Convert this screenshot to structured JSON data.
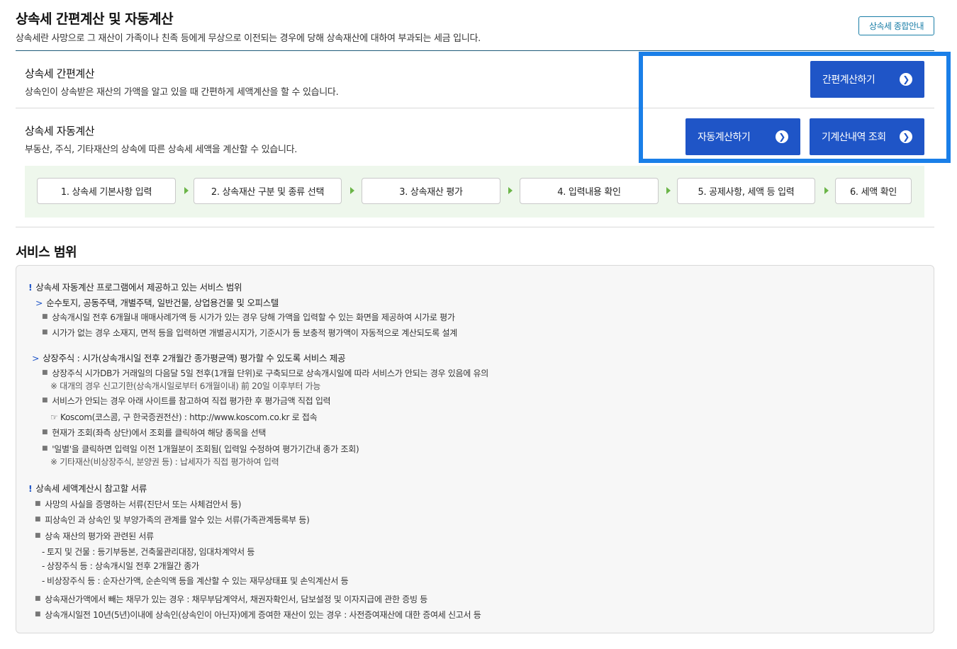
{
  "header": {
    "title": "상속세 간편계산 및 자동계산",
    "description": "상속세란 사망으로 그 재산이 가족이나 친족 등에게 무상으로 이전되는 경우에 당해 상속재산에 대하여 부과되는 세금 입니다.",
    "guide_button": "상속세 종합안내"
  },
  "simple_calc": {
    "title": "상속세 간편계산",
    "description": "상속인이 상속받은 재산의 가액을 알고 있을 때 간편하게 세액계산을 할 수 있습니다.",
    "button": "간편계산하기"
  },
  "auto_calc": {
    "title": "상속세 자동계산",
    "description": "부동산, 주식, 기타재산의 상속에 따른 상속세 세액을 계산할 수 있습니다.",
    "button": "자동계산하기",
    "history_button": "기계산내역 조회"
  },
  "steps": [
    "1. 상속세 기본사항 입력",
    "2. 상속재산 구분 및 종류 선택",
    "3. 상속재산 평가",
    "4. 입력내용 확인",
    "5. 공제사항, 세액 등 입력",
    "6. 세액 확인"
  ],
  "scope": {
    "title": "서비스 범위",
    "lines": [
      "상속세 자동계산 프로그램에서 제공하고 있는 서비스 범위",
      "순수토지, 공동주택, 개별주택, 일반건물, 상업용건물 및 오피스텔",
      "상속개시일 전후 6개월내 매매사례가액 등 시가가 있는 경우 당해 가액을 입력할 수 있는 화면을 제공하여 시가로 평가",
      "시가가 없는 경우 소재지, 면적 등을 입력하면 개별공시지가, 기준시가 등 보충적 평가액이 자동적으로 계산되도록 설계",
      "상장주식 : 시가(상속개시일 전후 2개월간 종가평균액) 평가할 수 있도록 서비스 제공",
      "상장주식 시가DB가 거래일의 다음달 5일 전후(1개월 단위)로 구축되므로 상속개시일에 따라 서비스가 안되는 경우 있음에 유의",
      "※ 대개의 경우 신고기한(상속개시일로부터 6개월이내) 前 20일 이후부터 가능",
      "서비스가 안되는 경우 아래 사이트를 참고하여 직접 평가한 후 평가금액 직접 입력",
      "☞ Koscom(코스콤, 구 한국증권전산) : http://www.koscom.co.kr 로 접속",
      "현재가 조회(좌측 상단)에서 조회를 클릭하여 해당 종목을 선택",
      "'일별'을 클릭하면 입력일 이전 1개월분이 조회됨( 입력일 수정하여 평가기간내 종가 조회)",
      "※ 기타재산(비상장주식, 분양권 등) : 납세자가 직접 평가하여 입력",
      "상속세 세액계산시 참고할 서류",
      "사망의 사실을 증명하는 서류(진단서 또는 사체검안서 등)",
      "피상속인 과 상속인 및 부양가족의 관계를 알수 있는 서류(가족관계등록부 등)",
      "상속 재산의 평가와 관련된 서류",
      "토지 및 건물 : 등기부등본, 건축물관리대장, 임대차계약서 등",
      "상장주식 등 : 상속개시일 전후 2개월간 종가",
      "비상장주식 등 : 순자산가액, 순손익액 등을 계산할 수 있는 재무상태표 및 손익계산서 등",
      "상속재산가액에서 빼는 채무가 있는 경우 : 채무부담계약서, 채권자확인서, 담보설정 및 이자지급에 관한 증빙 등",
      "상속개시일전 10년(5년)이내에 상속인(상속인이 아닌자)에게 증여한 재산이 있는 경우 : 사전증여재산에 대한 증여세 신고서 등"
    ]
  },
  "colors": {
    "primary_button": "#1f55c7",
    "highlight_border": "#1a7fe8",
    "steps_background": "#eef7ec",
    "step_arrow": "#6bb548"
  }
}
